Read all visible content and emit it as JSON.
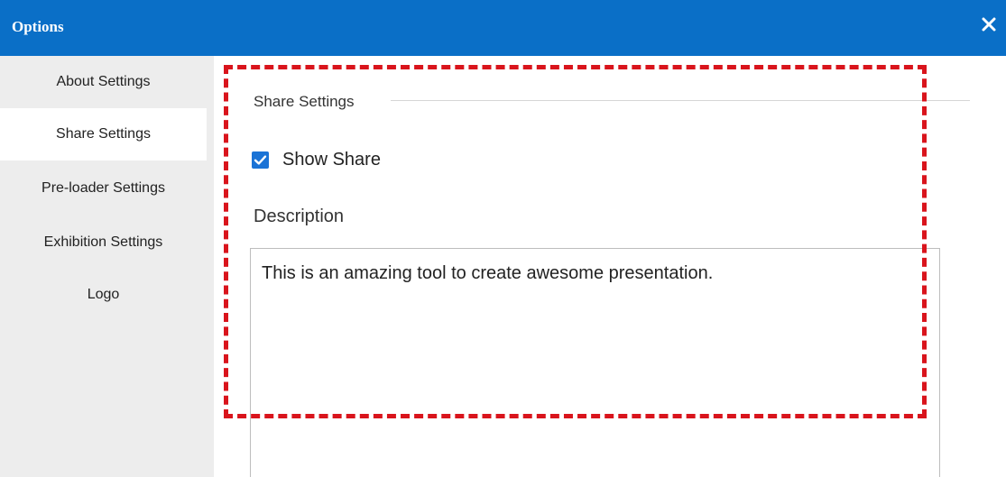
{
  "window": {
    "title": "Options",
    "close_icon": "close-icon",
    "titlebar_color": "#0a6fc7"
  },
  "sidebar": {
    "items": [
      {
        "label": "About Settings",
        "active": false
      },
      {
        "label": "Share Settings",
        "active": true
      },
      {
        "label": "Pre-loader Settings",
        "active": false
      },
      {
        "label": "Exhibition Settings",
        "active": false
      },
      {
        "label": "Logo",
        "active": false
      }
    ]
  },
  "share_settings": {
    "section_title": "Share Settings",
    "show_share": {
      "label": "Show Share",
      "checked": true
    },
    "description": {
      "label": "Description",
      "value": "This is an amazing tool to create awesome presentation."
    }
  },
  "annotation": {
    "highlight_color": "#d9141c",
    "style": "dashed"
  }
}
